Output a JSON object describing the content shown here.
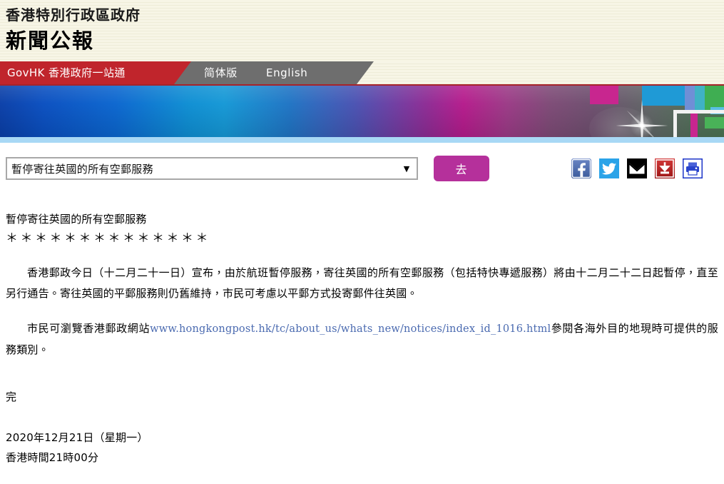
{
  "masthead": {
    "government_line": "香港特別行政區政府",
    "publication_title": "新聞公報"
  },
  "nav": {
    "govhk_label": "GovHK 香港政府一站通",
    "simplified_label": "简体版",
    "english_label": "English"
  },
  "controls": {
    "select_value": "暫停寄往英國的所有空郵服務",
    "select_arrow": "▼",
    "go_label": "去",
    "social": [
      {
        "name": "facebook-icon",
        "title": "Facebook"
      },
      {
        "name": "twitter-icon",
        "title": "Twitter"
      },
      {
        "name": "email-icon",
        "title": "Email"
      },
      {
        "name": "download-icon",
        "title": "Download"
      },
      {
        "name": "print-icon",
        "title": "Print"
      }
    ]
  },
  "article": {
    "headline": "暫停寄往英國的所有空郵服務",
    "asterisk_rule": "＊＊＊＊＊＊＊＊＊＊＊＊＊＊",
    "paragraph_1": "香港郵政今日（十二月二十一日）宣布，由於航班暫停服務，寄往英國的所有空郵服務（包括特快專遞服務）將由十二月二十二日起暫停，直至另行通告。寄往英國的平郵服務則仍舊維持，市民可考慮以平郵方式投寄郵件往英國。",
    "paragraph_2_prefix": "市民可瀏覽香港郵政網站",
    "paragraph_2_url": "www.hongkongpost.hk/tc/about_us/whats_new/notices/index_id_1016.html",
    "paragraph_2_suffix": "參閱各海外目的地現時可提供的服務類別。",
    "end_mark": "完",
    "date": "2020年12月21日（星期一）",
    "time": "香港時間21時00分"
  },
  "colors": {
    "nav_red": "#c0252c",
    "nav_grey": "#6e6e6e",
    "go_button": "#b5309b",
    "link_blue": "#4a6ab0",
    "banner_strip": "#a8d8f5",
    "masthead_cream": "#f6f4e4"
  }
}
